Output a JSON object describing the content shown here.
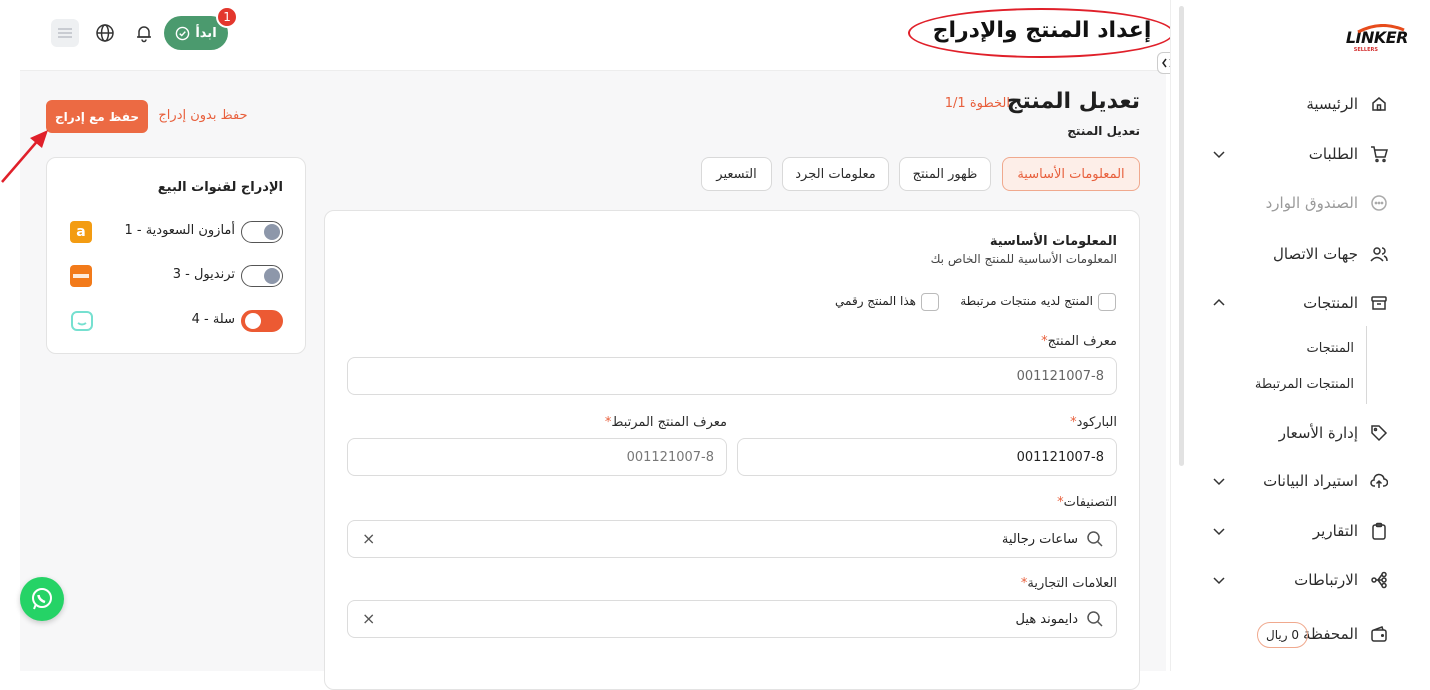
{
  "header": {
    "annotation_title": "إعداد المنتج والإدراج",
    "start_button_label": "ابدأ",
    "start_badge_count": "1"
  },
  "sidebar": {
    "logo_text": "LINKER",
    "logo_subtext": "SELLERS",
    "items": [
      {
        "label": "الرئيسية",
        "icon": "home-icon"
      },
      {
        "label": "الطلبات",
        "icon": "cart-icon"
      },
      {
        "label": "الصندوق الوارد",
        "icon": "chat-icon"
      },
      {
        "label": "جهات الاتصال",
        "icon": "users-icon"
      },
      {
        "label": "المنتجات",
        "icon": "box-icon"
      },
      {
        "label": "إدارة الأسعار",
        "icon": "tag-icon"
      },
      {
        "label": "استيراد البيانات",
        "icon": "upload-icon"
      },
      {
        "label": "التقارير",
        "icon": "clipboard-icon"
      },
      {
        "label": "الارتباطات",
        "icon": "integration-icon"
      },
      {
        "label": "المحفظة",
        "icon": "wallet-icon"
      }
    ],
    "sub_items": [
      "المنتجات",
      "المنتجات المرتبطة"
    ],
    "wallet_balance": "0 ريال"
  },
  "page": {
    "title": "تعديل المنتج",
    "step": "الخطوة 1/1",
    "subtitle": "تعديل المنتج",
    "save_with_listing": "حفظ مع إدراج",
    "save_without_listing": "حفظ بدون إدراج"
  },
  "tabs": [
    "المعلومات الأساسية",
    "ظهور المنتج",
    "معلومات الجرد",
    "التسعير"
  ],
  "basic_info": {
    "heading": "المعلومات الأساسية",
    "description": "المعلومات الأساسية للمنتج الخاص بك",
    "checkbox_linked": "المنتج لديه منتجات مرتبطة",
    "checkbox_digital": "هذا المنتج رقمي",
    "product_id_label": "معرف المنتج",
    "product_id_value": "001121007-8",
    "barcode_label": "الباركود",
    "barcode_value": "001121007-8",
    "linked_id_label": "معرف المنتج المرتبط",
    "linked_id_value": "001121007-8",
    "categories_label": "التصنيفات",
    "categories_value": "ساعات رجالية",
    "brands_label": "العلامات التجارية",
    "brands_value": "دايموند هيل",
    "required_mark": "*",
    "clear_mark": "×"
  },
  "channels": {
    "title": "الإدراج لقنوات البيع",
    "items": [
      {
        "label": "أمازون السعودية - 1",
        "enabled": false,
        "color": "#f39c12"
      },
      {
        "label": "ترنديول - 3",
        "enabled": false,
        "color": "#f27a1a"
      },
      {
        "label": "سلة - 4",
        "enabled": true,
        "color": "#76e0d0"
      }
    ]
  },
  "colors": {
    "accent": "#ec5a33",
    "annotation": "#e0202a"
  }
}
